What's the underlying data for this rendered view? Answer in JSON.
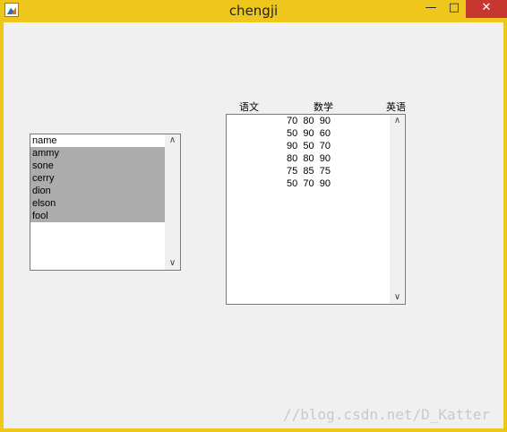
{
  "window": {
    "title": "chengji",
    "minimize_glyph": "—",
    "maximize_glyph": "□",
    "close_glyph": "✕"
  },
  "name_list": {
    "items": [
      "name",
      "ammy",
      "sone",
      "cerry",
      "dion",
      "elson",
      "fool"
    ],
    "selected": [
      "ammy",
      "sone",
      "cerry",
      "dion",
      "elson",
      "fool"
    ]
  },
  "score_list": {
    "headers": [
      "语文",
      "数学",
      "英语"
    ],
    "rows": [
      "70  80  90",
      "50  90  60",
      "90  50  70",
      "80  80  90",
      "75  85  75",
      "50  70  90"
    ]
  },
  "scroll": {
    "up": "∧",
    "down": "∨"
  },
  "watermark": "//blog.csdn.net/D_Katter",
  "colors": {
    "titlebar": "#efc71c",
    "close": "#c7372f",
    "selection": "#acacac"
  }
}
